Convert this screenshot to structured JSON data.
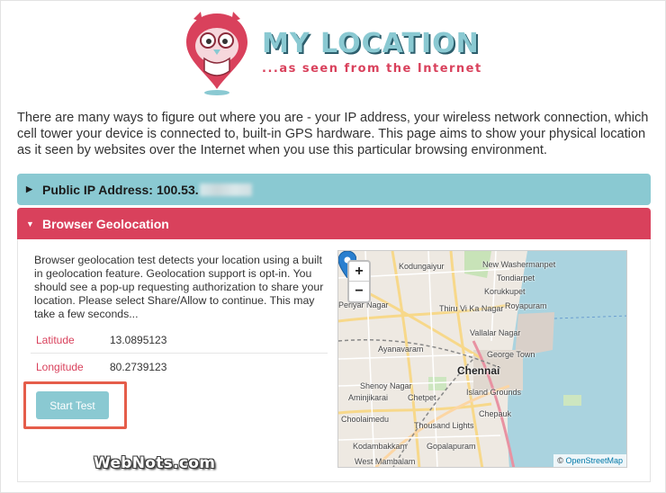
{
  "header": {
    "title": "MY LOCATION",
    "subtitle": "...as seen from the Internet"
  },
  "intro": "There are many ways to figure out where you are - your IP address, your wireless network connection, which cell tower your device is connected to, built-in GPS hardware. This page aims to show your physical location as it seen by websites over the Internet when you use this particular browsing environment.",
  "panels": {
    "ip": {
      "label": "Public IP Address:",
      "value": "100.53."
    },
    "geo": {
      "label": "Browser Geolocation"
    }
  },
  "geo": {
    "description": "Browser geolocation test detects your location using a built in geolocation feature. Geolocation support is opt-in. You should see a pop-up requesting authorization to share your location. Please select Share/Allow to continue. This may take a few seconds...",
    "rows": [
      {
        "label": "Latitude",
        "value": "13.0895123"
      },
      {
        "label": "Longitude",
        "value": "80.2739123"
      }
    ],
    "start_button": "Start Test"
  },
  "map": {
    "zoom_in": "+",
    "zoom_out": "−",
    "attribution_symbol": "©",
    "attribution_link": "OpenStreetMap",
    "labels": [
      "Kodungaiyur",
      "New Washermanpet",
      "Tondiarpet",
      "Korukkupet",
      "Periyar Nagar",
      "Thiru Vi Ka Nagar",
      "Royapuram",
      "Vallalar Nagar",
      "Ayanavaram",
      "George Town",
      "Chennai",
      "Shenoy Nagar",
      "Island Grounds",
      "Aminjikarai",
      "Chetpet",
      "Chepauk",
      "Choolaimedu",
      "Thousand Lights",
      "Kodambakkam",
      "Gopalapuram",
      "West Mambalam"
    ]
  },
  "watermark": "WebNots.com",
  "colors": {
    "teal": "#8ac9d2",
    "red": "#d9415c",
    "highlight": "#e55d4a"
  }
}
